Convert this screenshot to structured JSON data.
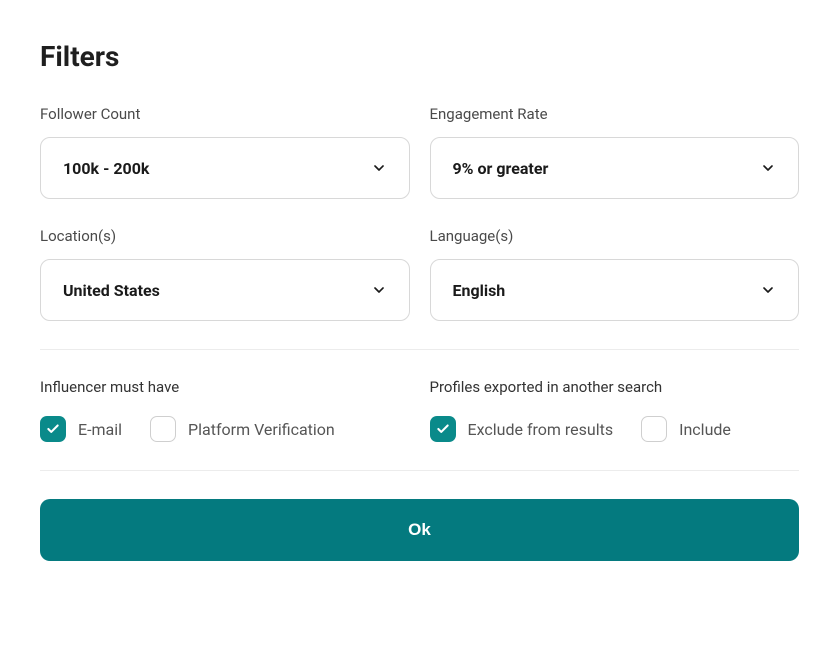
{
  "title": "Filters",
  "fields": {
    "follower_count": {
      "label": "Follower Count",
      "value": "100k - 200k"
    },
    "engagement_rate": {
      "label": "Engagement Rate",
      "value": "9% or greater"
    },
    "locations": {
      "label": "Location(s)",
      "value": "United States"
    },
    "languages": {
      "label": "Language(s)",
      "value": "English"
    }
  },
  "sections": {
    "must_have": {
      "label": "Influencer must have",
      "options": {
        "email": {
          "label": "E-mail",
          "checked": true
        },
        "platform_verification": {
          "label": "Platform Verification",
          "checked": false
        }
      }
    },
    "exported": {
      "label": "Profiles exported in another search",
      "options": {
        "exclude": {
          "label": "Exclude from results",
          "checked": true
        },
        "include": {
          "label": "Include",
          "checked": false
        }
      }
    }
  },
  "buttons": {
    "ok": "Ok"
  },
  "colors": {
    "accent": "#0a8a8a",
    "button": "#047a7f"
  }
}
